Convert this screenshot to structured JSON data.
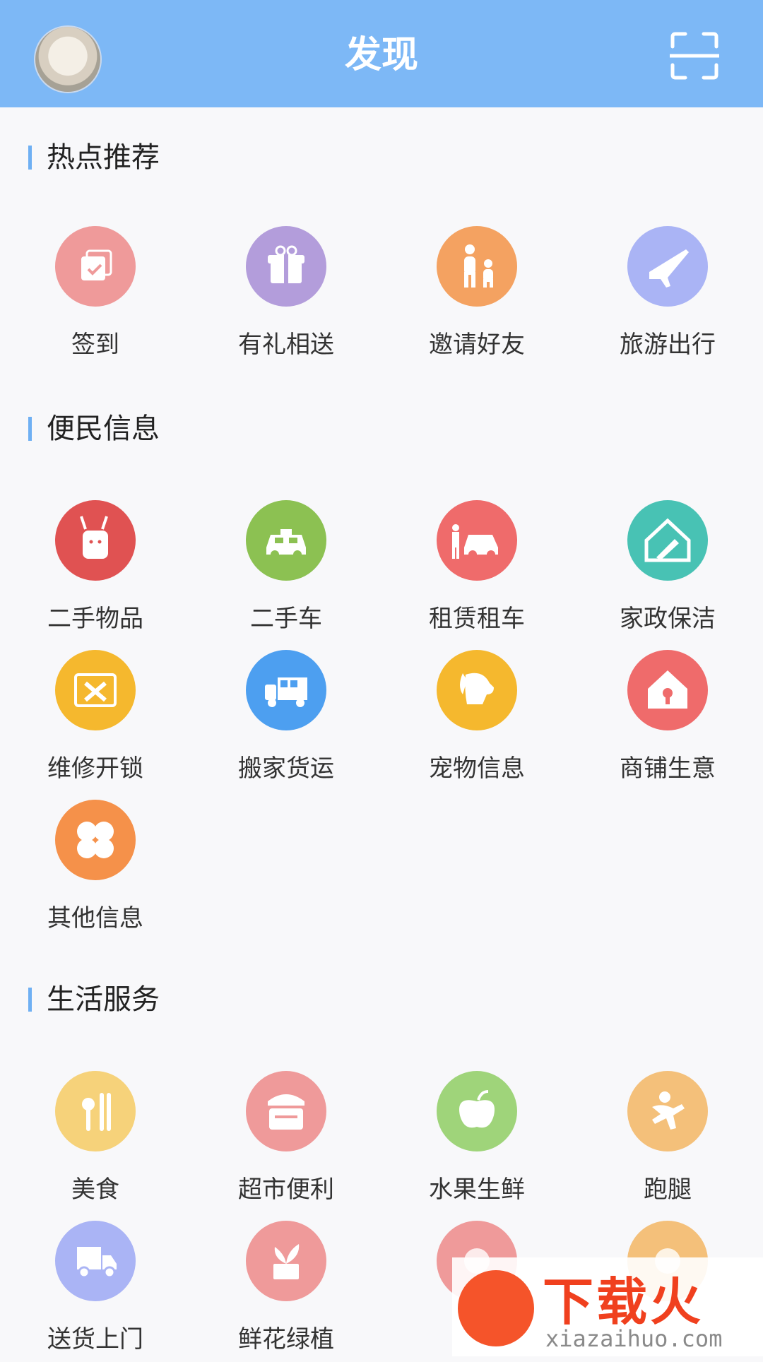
{
  "header": {
    "title": "发现"
  },
  "sections": [
    {
      "title": "热点推荐",
      "items": [
        {
          "label": "签到",
          "color": "#ef9a9a",
          "icon": "checkin-icon"
        },
        {
          "label": "有礼相送",
          "color": "#b39ddb",
          "icon": "gift-icon"
        },
        {
          "label": "邀请好友",
          "color": "#f4a261",
          "icon": "invite-friends-icon"
        },
        {
          "label": "旅游出行",
          "color": "#aab4f5",
          "icon": "airplane-icon"
        }
      ]
    },
    {
      "title": "便民信息",
      "items": [
        {
          "label": "二手物品",
          "color": "#e05252",
          "icon": "secondhand-goods-icon"
        },
        {
          "label": "二手车",
          "color": "#8cc152",
          "icon": "taxi-icon"
        },
        {
          "label": "租赁租车",
          "color": "#ef6b6b",
          "icon": "car-rental-icon"
        },
        {
          "label": "家政保洁",
          "color": "#48c2b4",
          "icon": "house-cleaning-icon"
        },
        {
          "label": "维修开锁",
          "color": "#f5b82e",
          "icon": "repair-tools-icon"
        },
        {
          "label": "搬家货运",
          "color": "#4d9ff0",
          "icon": "moving-truck-icon"
        },
        {
          "label": "宠物信息",
          "color": "#f5b82e",
          "icon": "dog-icon"
        },
        {
          "label": "商铺生意",
          "color": "#ef6b6b",
          "icon": "shop-house-icon"
        },
        {
          "label": "其他信息",
          "color": "#f5914a",
          "icon": "clover-icon"
        }
      ]
    },
    {
      "title": "生活服务",
      "items": [
        {
          "label": "美食",
          "color": "#f6d27a",
          "icon": "cutlery-icon"
        },
        {
          "label": "超市便利",
          "color": "#ef9a9a",
          "icon": "store-basket-icon"
        },
        {
          "label": "水果生鲜",
          "color": "#9fd47a",
          "icon": "apple-icon"
        },
        {
          "label": "跑腿",
          "color": "#f4c07a",
          "icon": "runner-icon"
        },
        {
          "label": "送货上门",
          "color": "#aab4f5",
          "icon": "delivery-truck-icon"
        },
        {
          "label": "鲜花绿植",
          "color": "#ef9a9a",
          "icon": "plant-icon"
        },
        {
          "label": "",
          "color": "#ef9a9a",
          "icon": "service-icon"
        },
        {
          "label": "",
          "color": "#f4c07a",
          "icon": "service-icon"
        }
      ]
    }
  ],
  "watermark": {
    "brand": "下载火",
    "url": "xiazaihuo.com"
  }
}
